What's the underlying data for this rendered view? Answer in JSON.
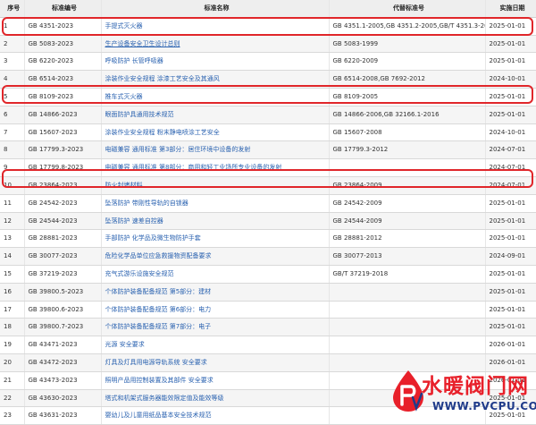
{
  "table": {
    "headers": [
      "序号",
      "标准编号",
      "标准名称",
      "代替标准号",
      "实施日期"
    ],
    "rows": [
      [
        "1",
        "GB 4351-2023",
        "手提式灭火器",
        "GB 4351.1-2005,GB 4351.2-2005,GB/T 4351.3-2005",
        "2025-01-01"
      ],
      [
        "2",
        "GB 5083-2023",
        "生产设备安全卫生设计总则",
        "GB 5083-1999",
        "2025-01-01"
      ],
      [
        "3",
        "GB 6220-2023",
        "呼吸防护 长管呼吸器",
        "GB 6220-2009",
        "2025-01-01"
      ],
      [
        "4",
        "GB 6514-2023",
        "涂装作业安全规程 涂漆工艺安全及其通风",
        "GB 6514-2008,GB 7692-2012",
        "2024-10-01"
      ],
      [
        "5",
        "GB 8109-2023",
        "推车式灭火器",
        "GB 8109-2005",
        "2025-01-01"
      ],
      [
        "6",
        "GB 14866-2023",
        "眼面防护具通用技术规范",
        "GB 14866-2006,GB 32166.1-2016",
        "2025-01-01"
      ],
      [
        "7",
        "GB 15607-2023",
        "涂装作业安全规程 粉末静电喷涂工艺安全",
        "GB 15607-2008",
        "2024-10-01"
      ],
      [
        "8",
        "GB 17799.3-2023",
        "电磁兼容 通用标准 第3部分：居住环境中设备的发射",
        "GB 17799.3-2012",
        "2024-07-01"
      ],
      [
        "9",
        "GB 17799.8-2023",
        "电磁兼容 通用标准 第8部分：商用和轻工业场所专业设备的发射",
        "",
        "2024-07-01"
      ],
      [
        "10",
        "GB 23864-2023",
        "防火封堵材料",
        "GB 23864-2009",
        "2024-07-01"
      ],
      [
        "11",
        "GB 24542-2023",
        "坠落防护 带刚性导轨的自锁器",
        "GB 24542-2009",
        "2025-01-01"
      ],
      [
        "12",
        "GB 24544-2023",
        "坠落防护 速差自控器",
        "GB 24544-2009",
        "2025-01-01"
      ],
      [
        "13",
        "GB 28881-2023",
        "手部防护 化学品及微生物防护手套",
        "GB 28881-2012",
        "2025-01-01"
      ],
      [
        "14",
        "GB 30077-2023",
        "危险化学品单位应急救援物资配备要求",
        "GB 30077-2013",
        "2024-09-01"
      ],
      [
        "15",
        "GB 37219-2023",
        "充气式游乐设施安全规范",
        "GB/T 37219-2018",
        "2025-01-01"
      ],
      [
        "16",
        "GB 39800.5-2023",
        "个体防护装备配备规范 第5部分：建材",
        "",
        "2025-01-01"
      ],
      [
        "17",
        "GB 39800.6-2023",
        "个体防护装备配备规范 第6部分：电力",
        "",
        "2025-01-01"
      ],
      [
        "18",
        "GB 39800.7-2023",
        "个体防护装备配备规范 第7部分：电子",
        "",
        "2025-01-01"
      ],
      [
        "19",
        "GB 43471-2023",
        "光源 安全要求",
        "",
        "2026-01-01"
      ],
      [
        "20",
        "GB 43472-2023",
        "灯具及灯具用电源导轨系统 安全要求",
        "",
        "2026-01-01"
      ],
      [
        "21",
        "GB 43473-2023",
        "照明产品用控制装置及其部件 安全要求",
        "",
        "2026-01-01"
      ],
      [
        "22",
        "GB 43630-2023",
        "塔式和机架式服务器能效限定值及能效等级",
        "",
        "2025-01-01"
      ],
      [
        "23",
        "GB 43631-2023",
        "婴幼儿及儿童用纸品基本安全技术规范",
        "",
        "2025-01-01"
      ]
    ],
    "highlighted_rows": [
      "1",
      "5",
      "10"
    ],
    "underlined_name_rows": [
      "2"
    ]
  },
  "watermark": {
    "text_cn": "水暖阀门网",
    "text_en": "WWW.PVCPU.COM"
  },
  "colors": {
    "highlight": "#e0262a",
    "link": "#2a62b0",
    "watermark_red": "#e8202a",
    "watermark_blue": "#1f3b8a"
  }
}
